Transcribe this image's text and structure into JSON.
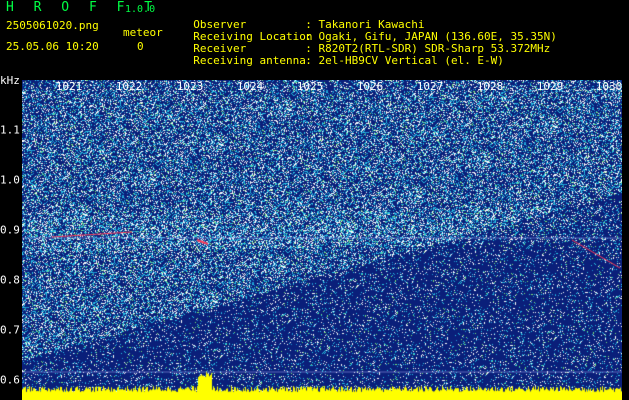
{
  "header": {
    "app_title": "H R O F F T",
    "version": "1.0.0",
    "filename": "2505061020.png",
    "meteor_label": "meteor",
    "datetime": "25.05.06 10:20",
    "meteor_count": "0",
    "info": [
      {
        "label": "Observer",
        "value": ": Takanori Kawachi"
      },
      {
        "label": "Receiving Location",
        "value": ": Ogaki, Gifu, JAPAN (136.60E, 35.35N)"
      },
      {
        "label": "Receiver",
        "value": ": R820T2(RTL-SDR) SDR-Sharp 53.372MHz"
      },
      {
        "label": "Receiving antenna",
        "value": ": 2el-HB9CV Vertical (el. E-W)"
      }
    ]
  },
  "axes": {
    "y_unit": "kHz",
    "x_ticks": [
      "1021",
      "1022",
      "1023",
      "1024",
      "1025",
      "1026",
      "1027",
      "1028",
      "1029",
      "1030"
    ],
    "y_ticks": [
      "1.1",
      "1.0",
      "0.9",
      "0.8",
      "0.7",
      "0.6"
    ]
  },
  "colors": {
    "background": "#0a1f7a",
    "text_header": "#ffff00",
    "text_title": "#00ff44",
    "text_axis": "#ffffff",
    "signal_bar": "#ffff00"
  }
}
